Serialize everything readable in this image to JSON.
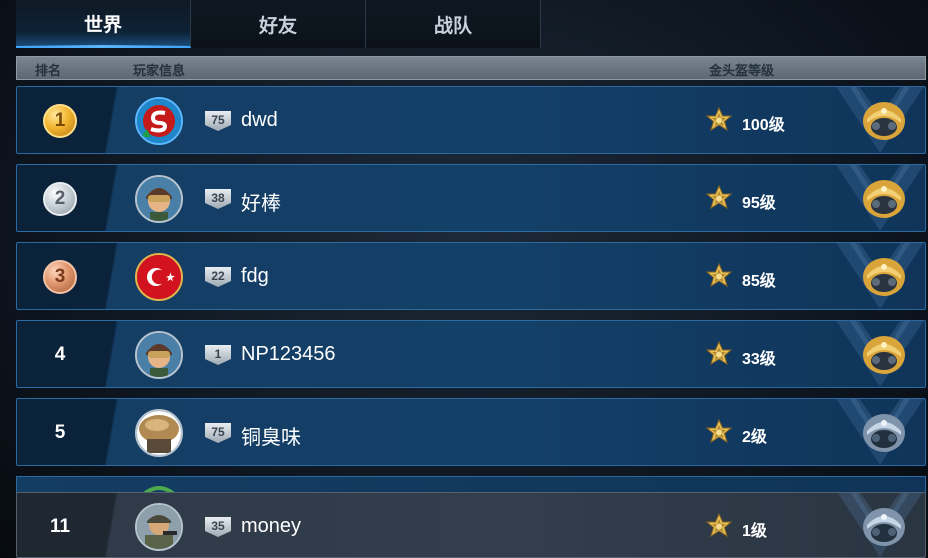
{
  "tabs": [
    {
      "label": "世界",
      "active": true
    },
    {
      "label": "好友",
      "active": false
    },
    {
      "label": "战队",
      "active": false
    }
  ],
  "header": {
    "rank_label": "排名",
    "player_info_label": "玩家信息",
    "helmet_level_label": "金头盔等级"
  },
  "rows": [
    {
      "rank": "1",
      "medal": "gold",
      "level": "75",
      "name": "dwd",
      "helmet_level": "100级",
      "avatar": "red-s-emblem",
      "helmet": "gold"
    },
    {
      "rank": "2",
      "medal": "silver",
      "level": "38",
      "name": "好棒",
      "helmet_level": "95级",
      "avatar": "pilot",
      "helmet": "gold"
    },
    {
      "rank": "3",
      "medal": "bronze",
      "level": "22",
      "name": "fdg",
      "helmet_level": "85级",
      "avatar": "turkey-flag",
      "helmet": "gold"
    },
    {
      "rank": "4",
      "medal": "none",
      "level": "1",
      "name": "NP123456",
      "helmet_level": "33级",
      "avatar": "pilot",
      "helmet": "gold"
    },
    {
      "rank": "5",
      "medal": "none",
      "level": "75",
      "name": "铜臭味",
      "helmet_level": "2级",
      "avatar": "tan-blob",
      "helmet": "silver"
    }
  ],
  "self_row": {
    "rank": "11",
    "level": "35",
    "name": "money",
    "helmet_level": "1级",
    "avatar": "soldier",
    "helmet": "silver"
  },
  "colors": {
    "accent": "#3fa3ff",
    "row_bg": "#134068",
    "gold": "#f2b52e",
    "silver": "#c9d1d8",
    "bronze": "#e0976e"
  }
}
